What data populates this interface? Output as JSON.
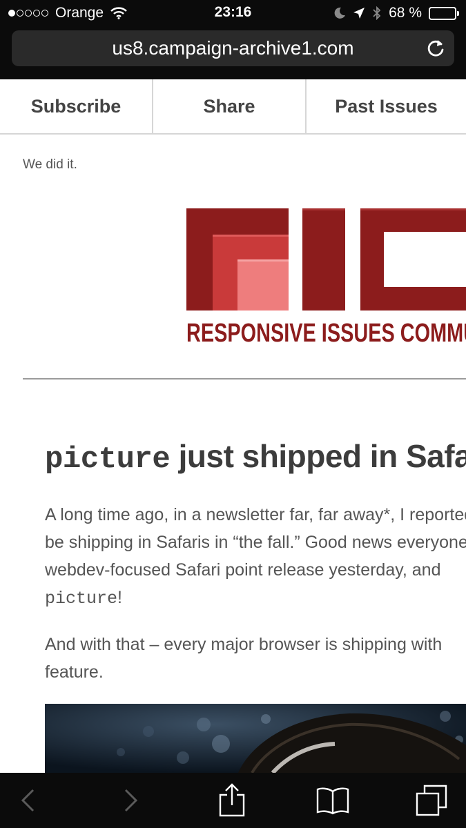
{
  "status_bar": {
    "carrier": "Orange",
    "time": "23:16",
    "battery_percent": "68 %",
    "battery_level": 0.68,
    "icons": [
      "signal-dots",
      "wifi-icon",
      "moon-icon",
      "location-arrow-icon",
      "bluetooth-icon",
      "battery-icon"
    ]
  },
  "browser": {
    "url": "us8.campaign-archive1.com",
    "reload_icon": "reload-icon",
    "toolbar_icons": [
      "back-icon",
      "forward-icon",
      "share-icon",
      "bookmarks-icon",
      "tabs-icon"
    ]
  },
  "nav": {
    "subscribe": "Subscribe",
    "share": "Share",
    "past_issues": "Past Issues"
  },
  "content": {
    "preheader": "We did it.",
    "logo_text": "RESPONSIVE ISSUES COMMUNITY",
    "headline_code": "picture",
    "headline_rest": " just shipped in Safari",
    "p1_line1": "A long time ago, in a newsletter far, far away*, I reported",
    "p1_line2": "be shipping in Safaris in “the fall.” Good news everyone!",
    "p1_line3": "webdev-focused Safari point release yesterday, and",
    "p1_code": "picture",
    "p1_end": "!",
    "p2_line1": "And with that – every major browser is shipping with",
    "p2_line2": "feature."
  },
  "colors": {
    "brand_dark": "#8c1c1c",
    "brand_mid": "#c93a3a",
    "brand_light": "#ee7d7d",
    "text": "#555555",
    "chrome": "#0b0b0b"
  }
}
